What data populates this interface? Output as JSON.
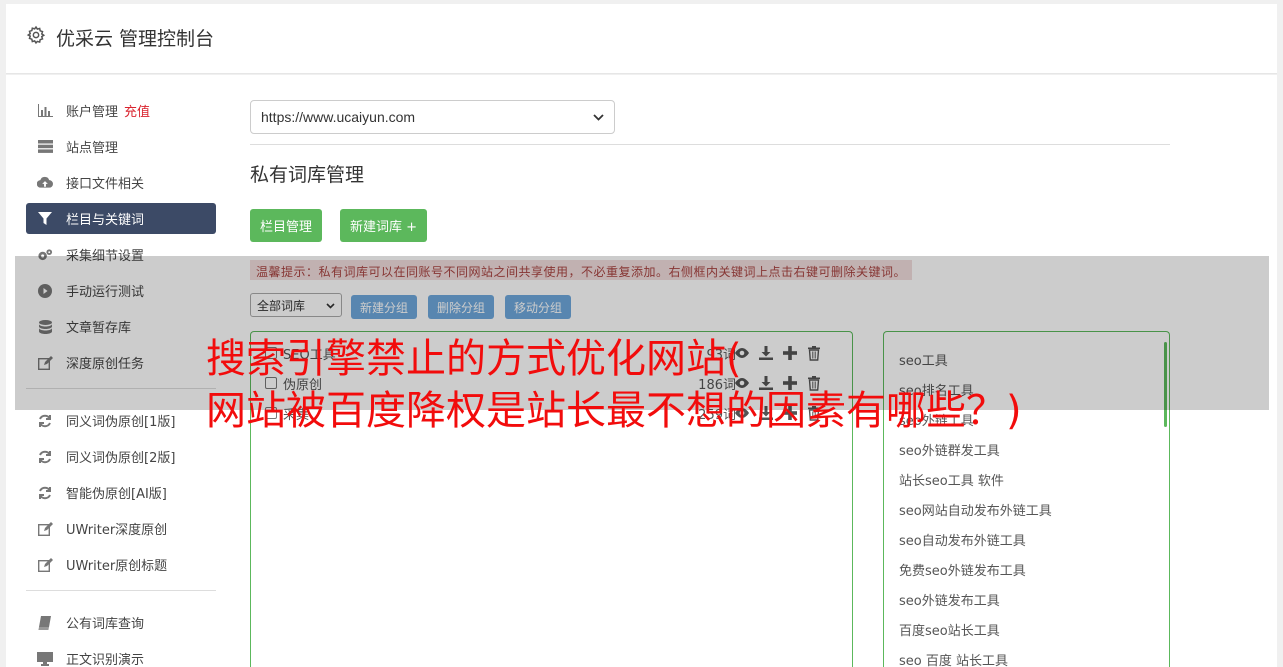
{
  "header": {
    "title": "优采云 管理控制台"
  },
  "sidebar": {
    "items": [
      {
        "label": "账户管理",
        "badge": "充值",
        "icon": "bar-chart-icon"
      },
      {
        "label": "站点管理",
        "icon": "server-icon"
      },
      {
        "label": "接口文件相关",
        "icon": "cloud-upload-icon"
      },
      {
        "label": "栏目与关键词",
        "icon": "filter-icon"
      },
      {
        "label": "采集细节设置",
        "icon": "gears-icon"
      },
      {
        "label": "手动运行测试",
        "icon": "play-circle-icon"
      },
      {
        "label": "文章暂存库",
        "icon": "database-icon"
      },
      {
        "label": "深度原创任务",
        "icon": "edit-icon"
      }
    ],
    "items2": [
      {
        "label": "同义词伪原创[1版]",
        "icon": "refresh-icon"
      },
      {
        "label": "同义词伪原创[2版]",
        "icon": "refresh-icon"
      },
      {
        "label": "智能伪原创[AI版]",
        "icon": "refresh-icon"
      },
      {
        "label": "UWriter深度原创",
        "icon": "edit-icon"
      },
      {
        "label": "UWriter原创标题",
        "icon": "edit-icon"
      }
    ],
    "items3": [
      {
        "label": "公有词库查询",
        "icon": "book-icon"
      },
      {
        "label": "正文识别演示",
        "icon": "monitor-icon"
      }
    ]
  },
  "content": {
    "site_select": "https://www.ucaiyun.com",
    "section_title": "私有词库管理",
    "btn_column": "栏目管理",
    "btn_new_lib": "新建词库 +",
    "tip": "温馨提示：私有词库可以在同账号不同网站之间共享使用，不必重复添加。右侧框内关键词上点击右键可删除关键词。",
    "lib_filter": "全部词库",
    "btn_new_group": "新建分组",
    "btn_del_group": "删除分组",
    "btn_move_group": "移动分组",
    "libraries": [
      {
        "name": "SEO工具",
        "count": "93词"
      },
      {
        "name": "伪原创",
        "count": "186词"
      },
      {
        "name": "采集",
        "count": "259词"
      }
    ],
    "keywords": [
      "seo工具",
      "seo排名工具",
      "seo外链工具",
      "seo外链群发工具",
      "站长seo工具 软件",
      "seo网站自动发布外链工具",
      "seo自动发布外链工具",
      "免费seo外链发布工具",
      "seo外链发布工具",
      "百度seo站长工具",
      "seo 百度 站长工具"
    ]
  },
  "banner": {
    "line1": "搜索引擎禁止的方式优化网站(",
    "line2": "网站被百度降权是站长最不想的因素有哪些？)"
  }
}
